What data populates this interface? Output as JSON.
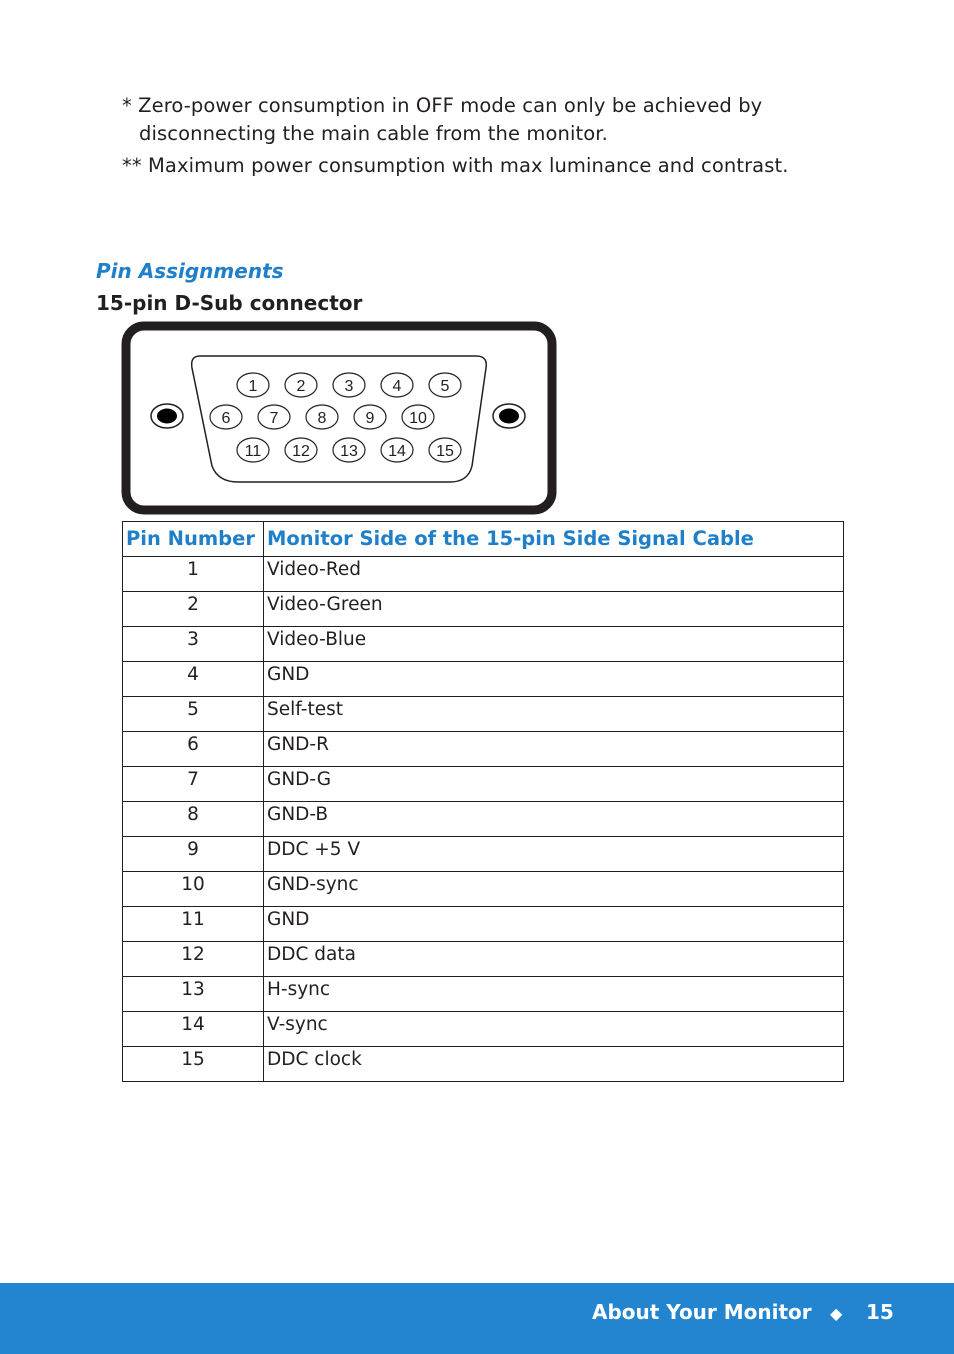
{
  "notes": {
    "note1_line1": "* Zero-power consumption in OFF mode can only be achieved by",
    "note1_line2": "disconnecting the main cable from the monitor.",
    "note2": "** Maximum power consumption with max luminance and contrast."
  },
  "section_title": "Pin Assignments",
  "sub_title": "15-pin D-Sub connector",
  "connector": {
    "row1": [
      "1",
      "2",
      "3",
      "4",
      "5"
    ],
    "row2": [
      "6",
      "7",
      "8",
      "9",
      "10"
    ],
    "row3": [
      "11",
      "12",
      "13",
      "14",
      "15"
    ]
  },
  "table": {
    "headers": [
      "Pin Number",
      "Monitor Side of the 15-pin Side Signal Cable"
    ],
    "rows": [
      [
        "1",
        "Video-Red"
      ],
      [
        "2",
        "Video-Green"
      ],
      [
        "3",
        "Video-Blue"
      ],
      [
        "4",
        "GND"
      ],
      [
        "5",
        "Self-test"
      ],
      [
        "6",
        "GND-R"
      ],
      [
        "7",
        "GND-G"
      ],
      [
        "8",
        "GND-B"
      ],
      [
        "9",
        "DDC +5 V"
      ],
      [
        "10",
        "GND-sync"
      ],
      [
        "11",
        "GND"
      ],
      [
        "12",
        "DDC data"
      ],
      [
        "13",
        "H-sync"
      ],
      [
        "14",
        "V-sync"
      ],
      [
        "15",
        "DDC clock"
      ]
    ]
  },
  "footer": {
    "title": "About Your Monitor",
    "separator": "◆",
    "page": "15"
  }
}
